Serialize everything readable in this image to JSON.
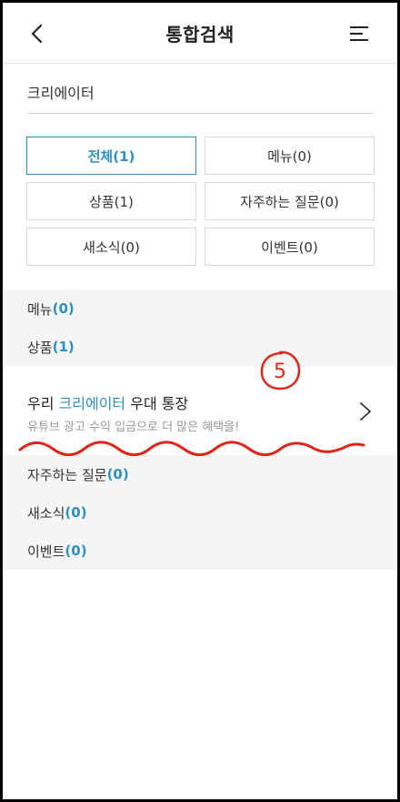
{
  "header": {
    "title": "통합검색",
    "back_icon": "chevron-left-icon",
    "menu_icon": "hamburger-menu-icon"
  },
  "search": {
    "value": "크리에이터"
  },
  "filters": [
    {
      "label": "전체(1)",
      "active": true
    },
    {
      "label": "메뉴(0)"
    },
    {
      "label": "상품(1)"
    },
    {
      "label": "자주하는 질문(0)"
    },
    {
      "label": "새소식(0)"
    },
    {
      "label": "이벤트(0)"
    }
  ],
  "categories": {
    "menu": {
      "label": "메뉴",
      "count": "(0)"
    },
    "product": {
      "label": "상품",
      "count": "(1)"
    },
    "faq": {
      "label": "자주하는 질문",
      "count": "(0)"
    },
    "news": {
      "label": "새소식",
      "count": "(0)"
    },
    "event": {
      "label": "이벤트",
      "count": "(0)"
    }
  },
  "result": {
    "title_prefix": "우리 ",
    "title_highlight": "크리에이터",
    "title_suffix": " 우대 통장",
    "description": "유튜브 광고 수익 입금으로 더 많은 혜택을!"
  },
  "annotation": {
    "marker_text": "5",
    "color": "#e0251b"
  },
  "colors": {
    "accent": "#2f8fbe"
  }
}
